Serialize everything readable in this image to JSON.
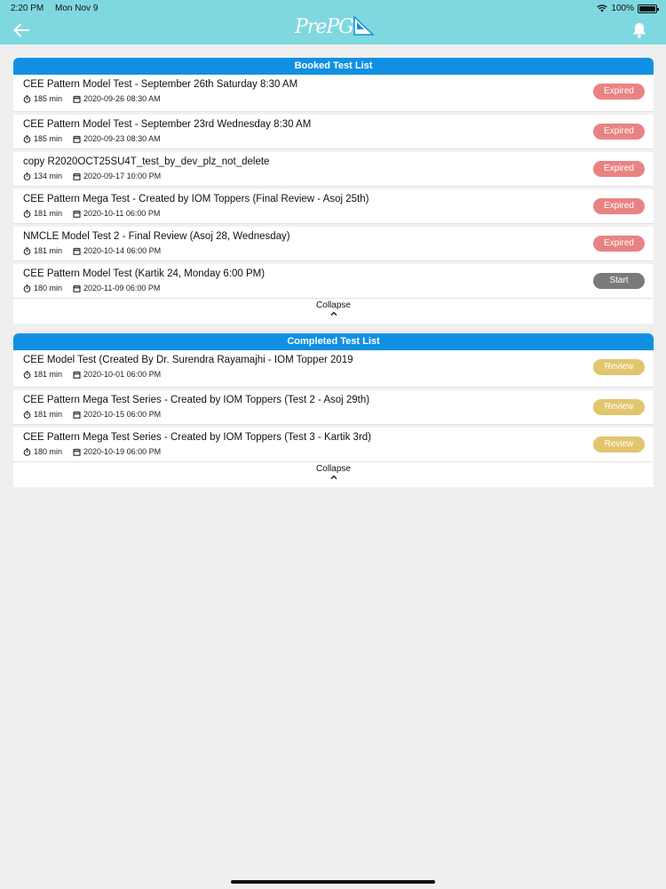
{
  "status_bar": {
    "time": "2:20 PM",
    "date": "Mon Nov 9",
    "battery": "100%",
    "battery_level_percent": 100
  },
  "header": {
    "logo_text": "PrePG",
    "icons": {
      "back": "arrow-left-icon",
      "notifications": "bell-icon",
      "wifi": "wifi-icon"
    }
  },
  "colors": {
    "header_bg": "#7fd8e0",
    "panel_header": "#1190e3",
    "expired": "#e98383",
    "start": "#7a7a7a",
    "review": "#e2c56d"
  },
  "booked": {
    "title": "Booked Test List",
    "collapse_label": "Collapse",
    "items": [
      {
        "title": "CEE Pattern Model Test - September 26th Saturday 8:30 AM",
        "duration": "185 min",
        "datetime": "2020-09-26 08:30 AM",
        "action": "Expired"
      },
      {
        "title": "CEE Pattern Model Test - September 23rd Wednesday 8:30 AM",
        "duration": "185 min",
        "datetime": "2020-09-23 08:30 AM",
        "action": "Expired"
      },
      {
        "title": "copy R2020OCT25SU4T_test_by_dev_plz_not_delete",
        "duration": "134 min",
        "datetime": "2020-09-17 10:00 PM",
        "action": "Expired"
      },
      {
        "title": "CEE Pattern Mega Test - Created by IOM Toppers (Final Review - Asoj 25th)",
        "duration": "181 min",
        "datetime": "2020-10-11 06:00 PM",
        "action": "Expired"
      },
      {
        "title": "NMCLE Model Test 2 - Final Review (Asoj 28, Wednesday)",
        "duration": "181 min",
        "datetime": "2020-10-14 06:00 PM",
        "action": "Expired"
      },
      {
        "title": "CEE Pattern Model Test (Kartik 24, Monday 6:00 PM)",
        "duration": "180 min",
        "datetime": "2020-11-09 06:00 PM",
        "action": "Start"
      }
    ]
  },
  "completed": {
    "title": "Completed Test List",
    "collapse_label": "Collapse",
    "items": [
      {
        "title": "CEE Model Test (Created By Dr. Surendra Rayamajhi - IOM Topper 2019",
        "duration": "181 min",
        "datetime": "2020-10-01 06:00 PM",
        "action": "Review"
      },
      {
        "title": "CEE Pattern Mega Test Series - Created by IOM Toppers (Test 2 - Asoj 29th)",
        "duration": "181 min",
        "datetime": "2020-10-15 06:00 PM",
        "action": "Review"
      },
      {
        "title": "CEE Pattern Mega Test Series - Created by IOM Toppers (Test 3 - Kartik 3rd)",
        "duration": "180 min",
        "datetime": "2020-10-19 06:00 PM",
        "action": "Review"
      }
    ]
  }
}
